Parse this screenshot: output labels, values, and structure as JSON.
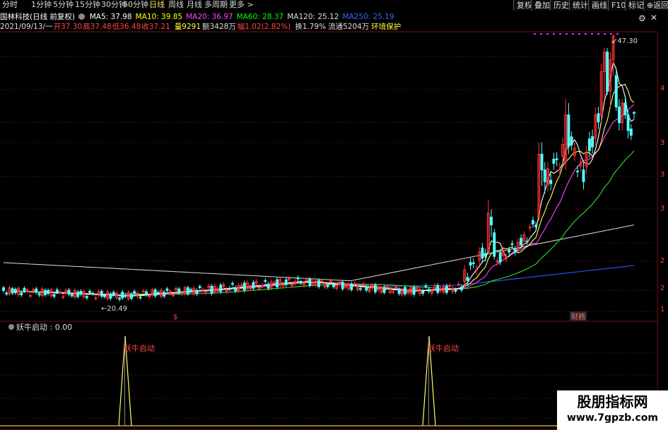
{
  "toolbar": {
    "periods": [
      "分时",
      "1分钟",
      "5分钟",
      "15分钟",
      "30分钟",
      "60分钟",
      "日线",
      "周线",
      "月线",
      "多周期",
      "更多"
    ],
    "active_period": "日线",
    "more_arrow": ">",
    "buttons": [
      "复权",
      "叠加",
      "历史",
      "统计",
      "画线",
      "F10",
      "标记",
      "⊕返回"
    ]
  },
  "info_line1": {
    "name": "国林科技(日线 前复权)",
    "ma": [
      {
        "label": "MA5: 37.98",
        "color": "#ffffff"
      },
      {
        "label": "MA10: 39.85",
        "color": "#ffff00"
      },
      {
        "label": "MA20: 36.97",
        "color": "#ff44ff"
      },
      {
        "label": "MA60: 28.37",
        "color": "#00ff00"
      },
      {
        "label": "MA120: 25.12",
        "color": "#dddddd"
      },
      {
        "label": "MA250: 25.19",
        "color": "#3366ff"
      }
    ]
  },
  "info_line2": {
    "date": "2021/09/13/一",
    "open": "开37.30",
    "high": "高37.48",
    "low": "低36.48",
    "close": "收37.21",
    "volume": "量9291",
    "amount": "额3428万",
    "change": "幅1.02(2.82%)",
    "turnover": "换1.79%",
    "float": "流通5204万",
    "tag": "环境保护"
  },
  "main_chart": {
    "high_label": "47.30",
    "low_label": "20.49",
    "markers": [
      "$",
      "财務"
    ],
    "right_axis": [
      "4",
      "3",
      "3",
      "3",
      "2",
      "2",
      "1"
    ],
    "colors": {
      "up": "#ff3333",
      "down": "#54ffff",
      "ma5": "#ffffff",
      "ma10": "#ffff66",
      "ma20": "#ff44ff",
      "ma60": "#33dd33",
      "ma120": "#cccccc",
      "ma250": "#3355ff"
    }
  },
  "sub_chart": {
    "label": "妖牛启动 : 0.00",
    "signal_text": "妖牛启动"
  },
  "watermark": {
    "title": "股朋指标网",
    "url": "www.7gpzb.com"
  }
}
